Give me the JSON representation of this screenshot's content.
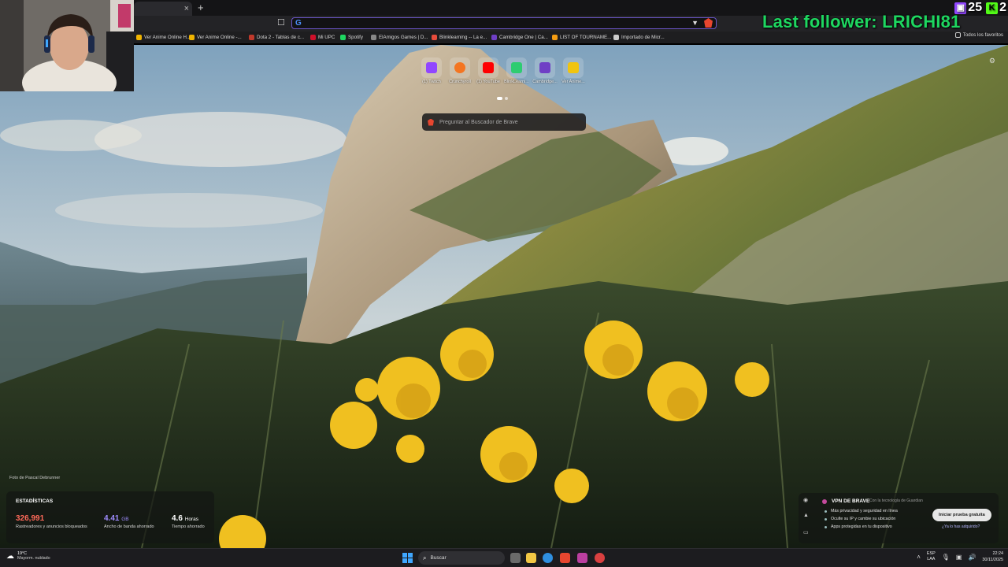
{
  "browser": {
    "tab_close_glyph": "×",
    "new_tab_glyph": "+",
    "url_value": "",
    "bookmark_glyph": "☐",
    "bookmarks": [
      {
        "label": "Ver Anime Online H...",
        "color": "#f0b400"
      },
      {
        "label": "Ver Anime Online -...",
        "color": "#f0b400"
      },
      {
        "label": "Dota 2 - Tablas de c...",
        "color": "#c0392b"
      },
      {
        "label": "Mi UPC",
        "color": "#d0102a"
      },
      {
        "label": "Spotify",
        "color": "#1ed760"
      },
      {
        "label": "ElAmigos Games | D...",
        "color": "#888888"
      },
      {
        "label": "Blinklearning -- La e...",
        "color": "#e74c3c"
      },
      {
        "label": "Cambridge One | Ca...",
        "color": "#6f3fc5"
      },
      {
        "label": "LIST OF TOURNAME...",
        "color": "#f39c12"
      },
      {
        "label": "Importado de Micr...",
        "color": "#cccccc"
      }
    ],
    "all_favorites_label": "Todos los favoritos"
  },
  "overlay": {
    "last_follower": "Last follower: LRICHI81",
    "twitch_count": "25",
    "kick_count": "2"
  },
  "newtab": {
    "tiles": [
      {
        "label": "(1) Twitch",
        "color": "#9146ff"
      },
      {
        "label": "Crunchyroll",
        "color": "#f47521"
      },
      {
        "label": "(1) YouTube",
        "color": "#ff0000"
      },
      {
        "label": "BlinkLearni...",
        "color": "#2ecc71"
      },
      {
        "label": "Cambridge...",
        "color": "#6f3fc5"
      },
      {
        "label": "Ver Anime...",
        "color": "#f1c40f"
      }
    ],
    "search_placeholder": "Preguntar al Buscador de Brave",
    "photo_credit": "Foto de Pascal Debrunner"
  },
  "stats": {
    "title": "ESTADÍSTICAS",
    "items": [
      {
        "value": "326,991",
        "unit": "",
        "label": "Rastreadores y anuncios bloqueados",
        "color": "#ff6a5a"
      },
      {
        "value": "4.41",
        "unit": "GB",
        "label": "Ancho de banda ahorrado",
        "color": "#9f8cff"
      },
      {
        "value": "4.6",
        "unit": "Horas",
        "label": "Tiempo ahorrado",
        "color": "#ffffff"
      }
    ]
  },
  "vpn": {
    "title": "VPN DE BRAVE",
    "brand": "Con la tecnología de Guardian",
    "bullets": [
      "Más privacidad y seguridad en línea",
      "Oculte su IP y cambie su ubicación",
      "Apps protegidas en tu dispositivo"
    ],
    "trial_button": "Iniciar prueba gratuita",
    "purchased_link": "¿Ya lo has adquirido?"
  },
  "taskbar": {
    "temp": "19°C",
    "weather_desc": "Mayorm. nublado",
    "search_label": "Buscar",
    "lang_1": "ESP",
    "lang_2": "LAA",
    "time": "22:24",
    "date": "30/11/2025",
    "apps": [
      "#6a6a6a",
      "#f2c744",
      "#2f8fe0",
      "#e8462f",
      "#bb3fa0",
      "#d94040"
    ]
  }
}
